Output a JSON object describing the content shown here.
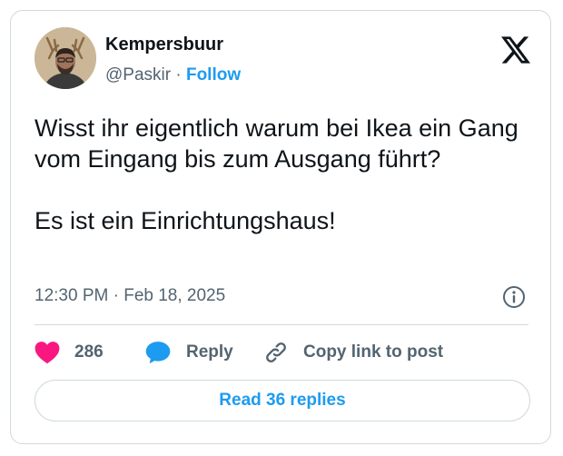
{
  "author": {
    "name": "Kempersbuur",
    "handle": "@Paskir",
    "separator": "·",
    "follow_label": "Follow"
  },
  "tweet": {
    "text_lines": [
      "Wisst ihr eigentlich warum bei Ikea ein Gang vom Eingang bis zum Ausgang führt?",
      "Es ist ein Einrichtungshaus!"
    ],
    "timestamp": "12:30 PM · Feb 18, 2025"
  },
  "actions": {
    "like_count": "286",
    "reply_label": "Reply",
    "copy_link_label": "Copy link to post"
  },
  "footer": {
    "read_replies_label": "Read 36 replies"
  },
  "icons": {
    "brand_logo": "x-logo-icon",
    "info": "info-icon",
    "like": "heart-icon",
    "reply": "speech-bubble-icon",
    "copy": "link-icon"
  },
  "colors": {
    "text": "#0f1419",
    "secondary": "#536471",
    "accent": "#1d9bf0",
    "like": "#f91880",
    "border": "#cfd9de"
  }
}
